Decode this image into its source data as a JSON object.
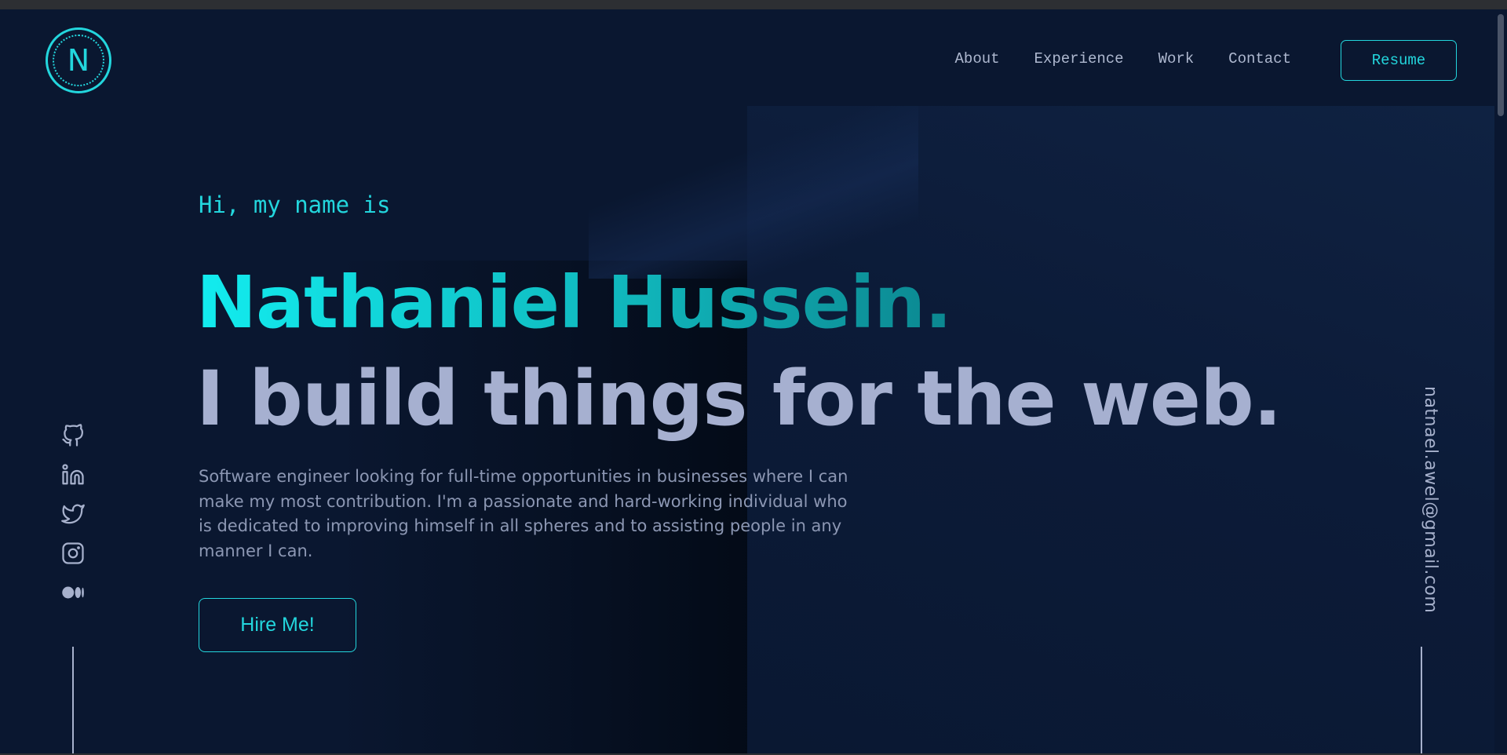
{
  "header": {
    "logo_letter": "N",
    "nav": [
      "About",
      "Experience",
      "Work",
      "Contact"
    ],
    "resume_label": "Resume"
  },
  "hero": {
    "intro": "Hi, my name is",
    "name": "Nathaniel Hussein.",
    "tagline": "I build things for the web.",
    "bio": "Software engineer looking for full-time opportunities in businesses where I can make my most contribution. I'm a passionate and hard-working individual who is dedicated to improving himself in all spheres and to assisting people in any manner I can.",
    "cta_label": "Hire Me!"
  },
  "social": {
    "icons": [
      "github-icon",
      "linkedin-icon",
      "twitter-icon",
      "instagram-icon",
      "medium-icon"
    ]
  },
  "email": "natnael.awel@gmail.com",
  "colors": {
    "accent": "#23d6dd",
    "background": "#0a1730",
    "text_muted": "#a7b1cc"
  }
}
